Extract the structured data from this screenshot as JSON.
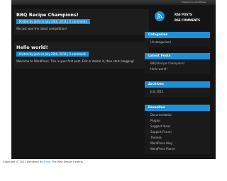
{
  "header": {
    "tagline": "Powered by WordPress"
  },
  "posts": [
    {
      "title": "BBQ Recipe Champions!",
      "meta": "Posted by josh on July 24th, 2011 | 0 comments",
      "excerpt": "We just won the latest competition!"
    },
    {
      "title": "Hello world!",
      "meta": "Posted by josh on July 20th, 2011 | 1 comment",
      "excerpt": "Welcome to WordPress. This is your first post. Edit or delete it, then start blogging!"
    }
  ],
  "sidebar": {
    "rss_posts": "RSS POSTS",
    "rss_comments": "RSS COMMENTS",
    "categories": {
      "title": "Categories",
      "items": [
        "Uncategorized"
      ]
    },
    "latest_posts": {
      "title": "Latest Posts",
      "items": [
        "BBQ Recipe Champions!",
        "Hello world!"
      ]
    },
    "archives": {
      "title": "Archives",
      "items": [
        "July 2011"
      ]
    },
    "favorites": {
      "title": "Favorites",
      "items": [
        "Documentation",
        "Plugins",
        "Suggest Ideas",
        "Support Forum",
        "Themes",
        "WordPress Blog",
        "WordPress Planet"
      ]
    }
  },
  "footer": {
    "prefix": "Copyright © 2011 Designed By ",
    "link": "Bingo",
    "suffix": " The Web Design Experts"
  },
  "colors": {
    "accent": "#1e90d6",
    "page_bg": "#141414"
  }
}
